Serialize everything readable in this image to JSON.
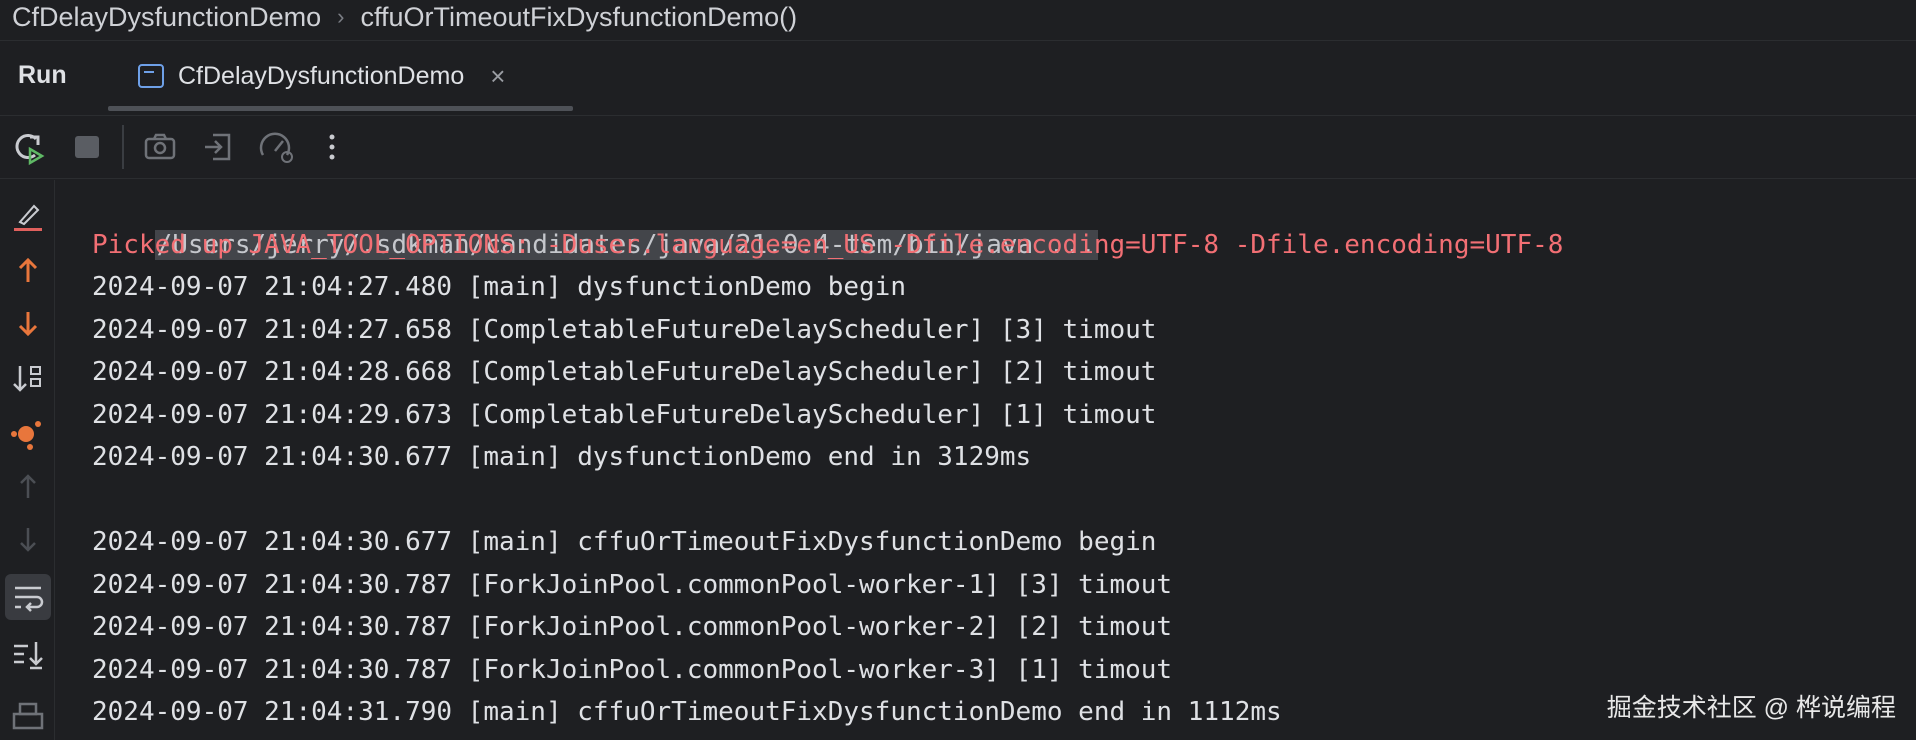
{
  "breadcrumb": {
    "class_name": "CfDelayDysfunctionDemo",
    "separator": "›",
    "method_name": "cffuOrTimeoutFixDysfunctionDemo()"
  },
  "run_panel": {
    "label": "Run",
    "tab_title": "CfDelayDysfunctionDemo",
    "tab_close": "×"
  },
  "toolbar": {
    "icons": [
      "rerun-icon",
      "stop-icon",
      "screenshot-icon",
      "exit-icon",
      "profiler-icon",
      "more-icon"
    ]
  },
  "gutter": {
    "icons": [
      "clear-icon",
      "scroll-up-icon",
      "scroll-down-icon",
      "sort-icon",
      "debug-node-icon",
      "prev-icon",
      "next-icon",
      "soft-wrap-icon",
      "scroll-to-end-icon",
      "print-icon"
    ]
  },
  "console": {
    "command_line": "/Users/jerry/.sdkman/candidates/java/21.0.4-tem/bin/java ...",
    "warning_line": "Picked up JAVA_TOOL_OPTIONS: -Duser.language=en_US -Dfile.encoding=UTF-8 -Dfile.encoding=UTF-8",
    "lines": [
      "2024-09-07 21:04:27.480 [main] dysfunctionDemo begin",
      "2024-09-07 21:04:27.658 [CompletableFutureDelayScheduler] [3] timout",
      "2024-09-07 21:04:28.668 [CompletableFutureDelayScheduler] [2] timout",
      "2024-09-07 21:04:29.673 [CompletableFutureDelayScheduler] [1] timout",
      "2024-09-07 21:04:30.677 [main] dysfunctionDemo end in 3129ms",
      "",
      "2024-09-07 21:04:30.677 [main] cffuOrTimeoutFixDysfunctionDemo begin",
      "2024-09-07 21:04:30.787 [ForkJoinPool.commonPool-worker-1] [3] timout",
      "2024-09-07 21:04:30.787 [ForkJoinPool.commonPool-worker-2] [2] timout",
      "2024-09-07 21:04:30.787 [ForkJoinPool.commonPool-worker-3] [1] timout",
      "2024-09-07 21:04:31.790 [main] cffuOrTimeoutFixDysfunctionDemo end in 1112ms"
    ]
  },
  "watermark": "掘金技术社区 @ 桦说编程",
  "colors": {
    "background": "#1e1f22",
    "warning": "#f26f74",
    "accent_orange": "#e8763c",
    "accent_red": "#e0605d"
  }
}
